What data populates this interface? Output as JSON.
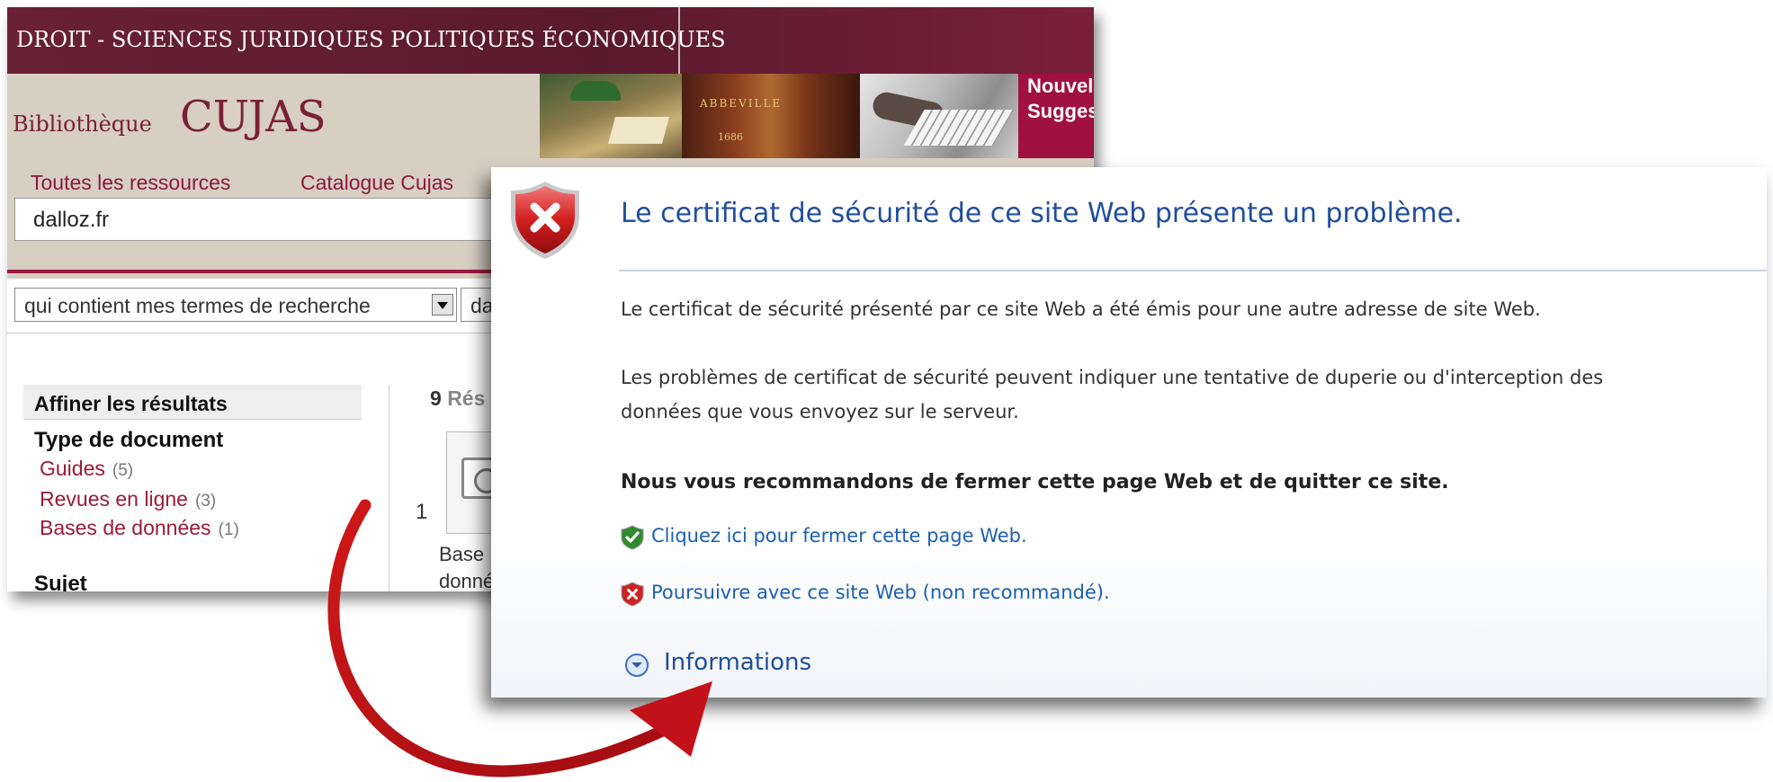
{
  "library": {
    "top_banner": "DROIT - SCIENCES JURIDIQUES POLITIQUES ÉCONOMIQUES",
    "brand_small": "Bibliothèque",
    "brand_big": "CUJAS",
    "news_line1": "Nouvel",
    "news_line2": "Sugges",
    "tabs": [
      "Toutes les ressources",
      "Catalogue Cujas"
    ],
    "search_value": "dalloz.fr",
    "filter_select": "qui contient mes termes de recherche",
    "filter_select2": "da",
    "sidebar": {
      "heading": "Affiner les résultats",
      "category1": "Type de document",
      "links": [
        {
          "label": "Guides",
          "count": "(5)"
        },
        {
          "label": "Revues en ligne",
          "count": "(3)"
        },
        {
          "label": "Bases de données",
          "count": "(1)"
        }
      ],
      "category2": "Sujet"
    },
    "results": {
      "count": "9",
      "count_rest": "Rés",
      "item_number": "1",
      "item_line1": "Base",
      "item_line2": "donné"
    }
  },
  "dialog": {
    "title": "Le certificat de sécurité de ce site Web présente un problème.",
    "message1": "Le certificat de sécurité présenté par ce site Web a été émis pour une autre adresse de site Web.",
    "message2_line1": "Les problèmes de certificat de sécurité peuvent indiquer une tentative de duperie ou d'interception des",
    "message2_line2": "données que vous envoyez sur le serveur.",
    "recommendation": "Nous vous recommandons de fermer cette page Web et de quitter ce site.",
    "option_close": "Cliquez ici pour fermer cette page Web.",
    "option_continue": "Poursuivre avec ce site Web (non recommandé).",
    "more_info": "Informations"
  },
  "colors": {
    "library_accent": "#7a2035",
    "link_red": "#9a1a3a",
    "dialog_title_blue": "#1f4e9c",
    "dialog_link_blue": "#1c5fb0",
    "arrow_red": "#b01019"
  },
  "icons": {
    "error_shield": "red-shield-x-icon",
    "safe_shield": "green-shield-check-icon",
    "unsafe_shield": "red-shield-x-small-icon",
    "expand": "chevron-down-circle-icon",
    "arrow": "curved-red-arrow"
  }
}
